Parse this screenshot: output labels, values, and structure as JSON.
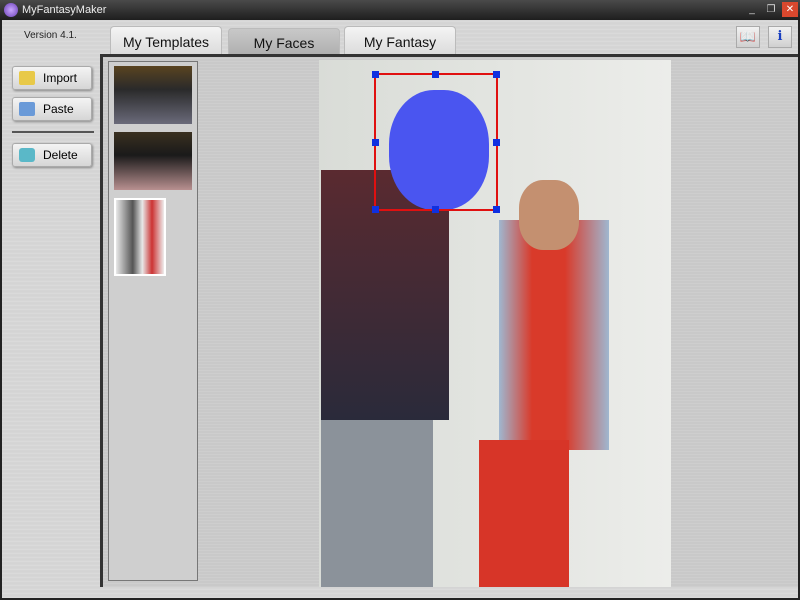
{
  "window": {
    "title": "MyFantasyMaker",
    "minimize": "_",
    "restore": "❐",
    "close": "✕"
  },
  "version": "Version 4.1.",
  "tabs": [
    {
      "label": "My Templates"
    },
    {
      "label": "My Faces"
    },
    {
      "label": "My Fantasy"
    }
  ],
  "active_tab": "My Faces",
  "sidebar": {
    "import": "Import",
    "paste": "Paste",
    "delete": "Delete"
  },
  "toolbar": {
    "help_icon": "book-icon",
    "info_icon": "info-icon",
    "info_glyph": "i"
  },
  "thumbnails": [
    "group-photo-1",
    "group-photo-2",
    "couple-photo"
  ],
  "selection_color": "#e01010"
}
